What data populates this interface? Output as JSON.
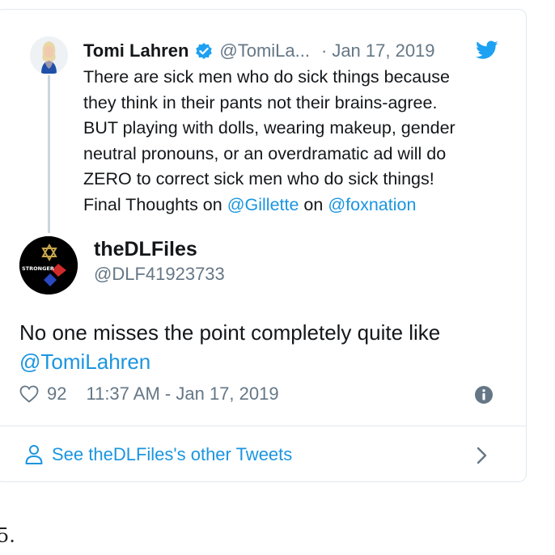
{
  "quoted_tweet": {
    "author_name": "Tomi Lahren",
    "handle": "@TomiLa...",
    "separator": "·",
    "date": "Jan 17, 2019",
    "text_lines": [
      "There are sick men who do sick things because",
      "they think in their pants not their brains-agree.",
      "BUT playing with dolls, wearing makeup, gender",
      "neutral pronouns, or an overdramatic ad will do",
      "ZERO to correct sick men who do sick things!"
    ],
    "last_line_prefix": "Final Thoughts on ",
    "mention_1": "@Gillette",
    "last_line_middle": " on ",
    "mention_2": "@foxnation"
  },
  "tweet": {
    "author_name": "theDLFiles",
    "handle": "@DLF41923733",
    "avatar_text": "STRONGER",
    "text": "No one misses the point completely quite like",
    "mention": "@TomiLahren",
    "likes": "92",
    "timestamp": "11:37 AM - Jan 17, 2019"
  },
  "footer": {
    "link_label": "See theDLFiles's other Tweets"
  },
  "caption": "5.",
  "colors": {
    "link": "#1b95e0",
    "secondary_text": "#657786",
    "border": "#e1e8ed",
    "verified": "#1da1f2"
  },
  "icons": [
    "verified-badge-icon",
    "twitter-bird-icon",
    "heart-icon",
    "info-icon",
    "person-icon",
    "chevron-right-icon"
  ]
}
